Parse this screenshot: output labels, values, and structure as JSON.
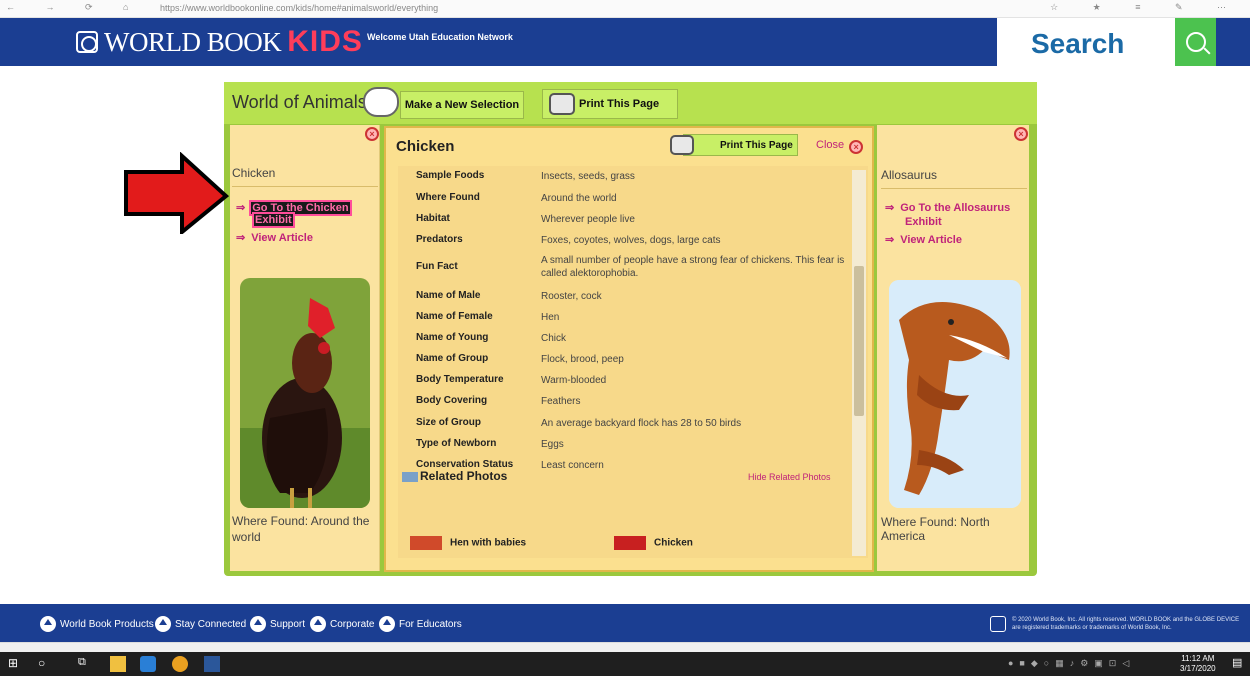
{
  "browser": {
    "url": "https://www.worldbookonline.com/kids/home#animalsworld/everything"
  },
  "header": {
    "logo_world": "WORLD BOOK",
    "logo_kids": "KIDS",
    "welcome": "Welcome Utah Education Network",
    "search_label": "Search"
  },
  "toolbar": {
    "title": "World of Animals",
    "new_selection": "Make a New Selection",
    "print": "Print This Page"
  },
  "left": {
    "name": "Chicken",
    "goto_line1": "Go To the Chicken",
    "goto_line2": "Exhibit",
    "view_article": "View Article",
    "where_found": "Where Found: Around the world"
  },
  "right": {
    "name": "Allosaurus",
    "goto_line1": "Go To the Allosaurus",
    "goto_line2": "Exhibit",
    "view_article": "View Article",
    "where_found": "Where Found: North America"
  },
  "center": {
    "title": "Chicken",
    "print": "Print This Page",
    "close": "Close",
    "facts": [
      {
        "k": "Sample Foods",
        "v": "Insects, seeds, grass"
      },
      {
        "k": "Where Found",
        "v": "Around the world"
      },
      {
        "k": "Habitat",
        "v": "Wherever people live"
      },
      {
        "k": "Predators",
        "v": "Foxes, coyotes, wolves, dogs, large cats"
      },
      {
        "k": "Fun Fact",
        "v": "A small number of people have a strong fear of chickens. This fear is called alektorophobia."
      },
      {
        "k": "Name of Male",
        "v": "Rooster, cock"
      },
      {
        "k": "Name of Female",
        "v": "Hen"
      },
      {
        "k": "Name of Young",
        "v": "Chick"
      },
      {
        "k": "Name of Group",
        "v": "Flock, brood, peep"
      },
      {
        "k": "Body Temperature",
        "v": "Warm-blooded"
      },
      {
        "k": "Body Covering",
        "v": "Feathers"
      },
      {
        "k": "Size of Group",
        "v": "An average backyard flock has 28 to 50 birds"
      },
      {
        "k": "Type of Newborn",
        "v": "Eggs"
      },
      {
        "k": "Conservation Status",
        "v": "Least concern"
      }
    ],
    "related_title": "Related Photos",
    "hide_related": "Hide Related Photos",
    "related": [
      "Hen with babies",
      "Chicken"
    ]
  },
  "footer": {
    "links": [
      "World Book Products",
      "Stay Connected",
      "Support",
      "Corporate",
      "For Educators"
    ],
    "copyright": "© 2020 World Book, Inc. All rights reserved. WORLD BOOK and the GLOBE DEVICE are registered trademarks or trademarks of World Book, Inc."
  },
  "taskbar": {
    "time": "11:12 AM",
    "date": "3/17/2020"
  },
  "colors": {
    "header": "#1b3e92",
    "frame": "#9bc83d",
    "kids": "#ff3d5a",
    "link": "#c0237a",
    "search_button": "#4cc24f"
  }
}
